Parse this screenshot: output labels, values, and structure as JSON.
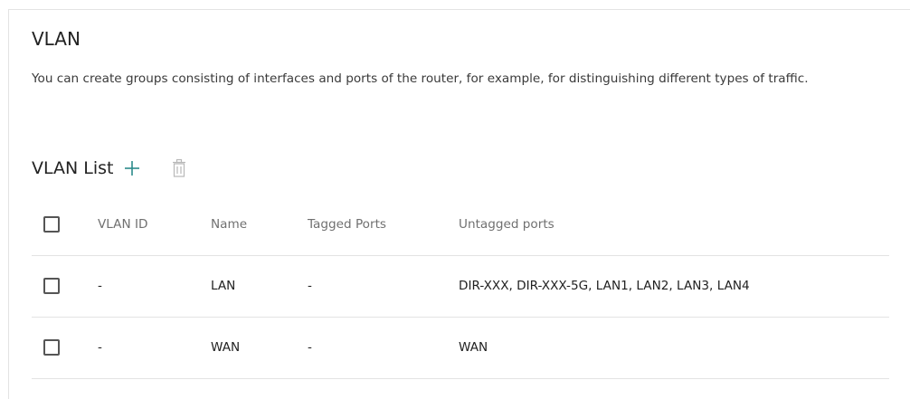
{
  "page": {
    "title": "VLAN",
    "description": "You can create groups consisting of interfaces and ports of the router, for example, for distinguishing different types of traffic."
  },
  "vlan_list": {
    "title": "VLAN List",
    "add_icon": "plus-icon",
    "delete_icon": "trash-icon",
    "accent_color": "#2b8a8a",
    "disabled_color": "#b8b8b8",
    "columns": {
      "vlan_id": "VLAN ID",
      "name": "Name",
      "tagged_ports": "Tagged Ports",
      "untagged_ports": "Untagged ports"
    },
    "rows": [
      {
        "vlan_id": "-",
        "name": "LAN",
        "tagged_ports": "-",
        "untagged_ports": "DIR-XXX, DIR-XXX-5G, LAN1, LAN2, LAN3, LAN4"
      },
      {
        "vlan_id": "-",
        "name": "WAN",
        "tagged_ports": "-",
        "untagged_ports": "WAN"
      }
    ]
  }
}
